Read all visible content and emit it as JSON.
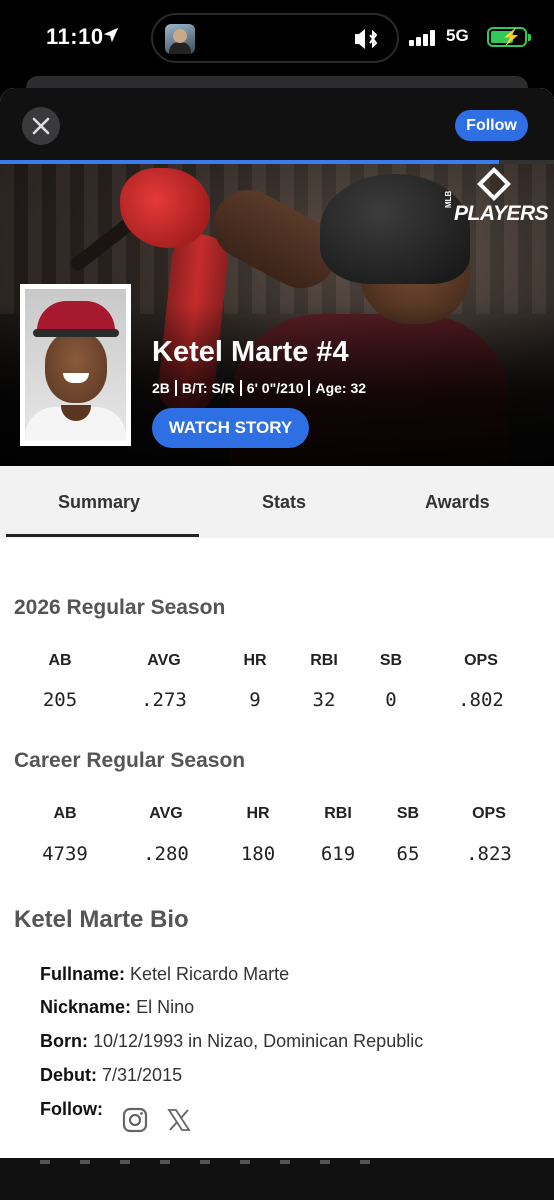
{
  "status_bar": {
    "time": "11:10",
    "network": "5G",
    "icons": [
      "location-arrow-icon",
      "bluetooth-icon",
      "signal-icon",
      "battery-charging-icon"
    ]
  },
  "header": {
    "close_icon": "close-icon",
    "follow_label": "Follow",
    "story_progress": 0.9
  },
  "hero": {
    "brand_text": "PLAYERS",
    "brand_small": "MLB",
    "player_name": "Ketel Marte #4",
    "meta": [
      "2B",
      "B/T: S/R",
      "6' 0\"/210",
      "Age: 32"
    ],
    "watch_label": "WATCH STORY"
  },
  "tabs": [
    {
      "label": "Summary",
      "selected": true
    },
    {
      "label": "Stats",
      "selected": false
    },
    {
      "label": "Awards",
      "selected": false
    }
  ],
  "season": {
    "title": "2026 Regular Season",
    "headers": [
      "AB",
      "AVG",
      "HR",
      "RBI",
      "SB",
      "OPS"
    ],
    "values": [
      "205",
      ".273",
      "9",
      "32",
      "0",
      ".802"
    ]
  },
  "career": {
    "title": "Career Regular Season",
    "headers": [
      "AB",
      "AVG",
      "HR",
      "RBI",
      "SB",
      "OPS"
    ],
    "values": [
      "4739",
      ".280",
      "180",
      "619",
      "65",
      ".823"
    ]
  },
  "bio": {
    "title": "Ketel Marte Bio",
    "fullname_label": "Fullname:",
    "fullname": "Ketel Ricardo Marte",
    "nickname_label": "Nickname:",
    "nickname": "El Nino",
    "born_label": "Born:",
    "born": "10/12/1993 in Nizao, Dominican Republic",
    "debut_label": "Debut:",
    "debut": "7/31/2015",
    "follow_label": "Follow:",
    "social_icons": [
      "instagram-icon",
      "x-twitter-icon"
    ]
  },
  "colors": {
    "accent_blue": "#2f6fe4",
    "background_dark": "#111111"
  }
}
